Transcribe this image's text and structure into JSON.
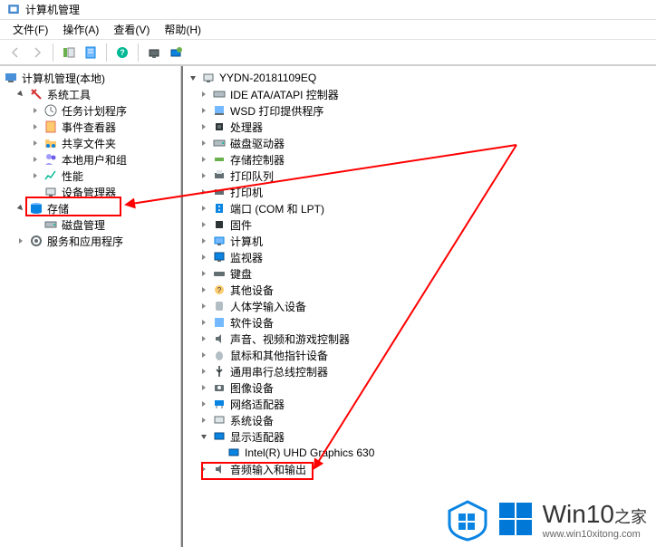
{
  "window": {
    "title": "计算机管理"
  },
  "menu": {
    "file": "文件(F)",
    "action": "操作(A)",
    "view": "查看(V)",
    "help": "帮助(H)"
  },
  "left_tree": {
    "root": "计算机管理(本地)",
    "system_tools": "系统工具",
    "task_scheduler": "任务计划程序",
    "event_viewer": "事件查看器",
    "shared_folders": "共享文件夹",
    "local_users": "本地用户和组",
    "performance": "性能",
    "device_manager": "设备管理器",
    "storage": "存储",
    "disk_management": "磁盘管理",
    "services_apps": "服务和应用程序"
  },
  "right_tree": {
    "root": "YYDN-20181109EQ",
    "ide": "IDE ATA/ATAPI 控制器",
    "wsd": "WSD 打印提供程序",
    "processors": "处理器",
    "disk_drives": "磁盘驱动器",
    "storage_ctrl": "存储控制器",
    "print_queues": "打印队列",
    "printers": "打印机",
    "ports": "端口 (COM 和 LPT)",
    "firmware": "固件",
    "computer": "计算机",
    "monitors": "监视器",
    "keyboards": "键盘",
    "other_devices": "其他设备",
    "hid": "人体学输入设备",
    "software_devices": "软件设备",
    "sound": "声音、视频和游戏控制器",
    "mice": "鼠标和其他指针设备",
    "usb": "通用串行总线控制器",
    "imaging": "图像设备",
    "network": "网络适配器",
    "system_devices": "系统设备",
    "display_adapters": "显示适配器",
    "display_child": "Intel(R) UHD Graphics 630",
    "audio_io": "音频输入和输出"
  },
  "watermark": {
    "brand": "Win10",
    "suffix": "之家",
    "url": "www.win10xitong.com"
  }
}
